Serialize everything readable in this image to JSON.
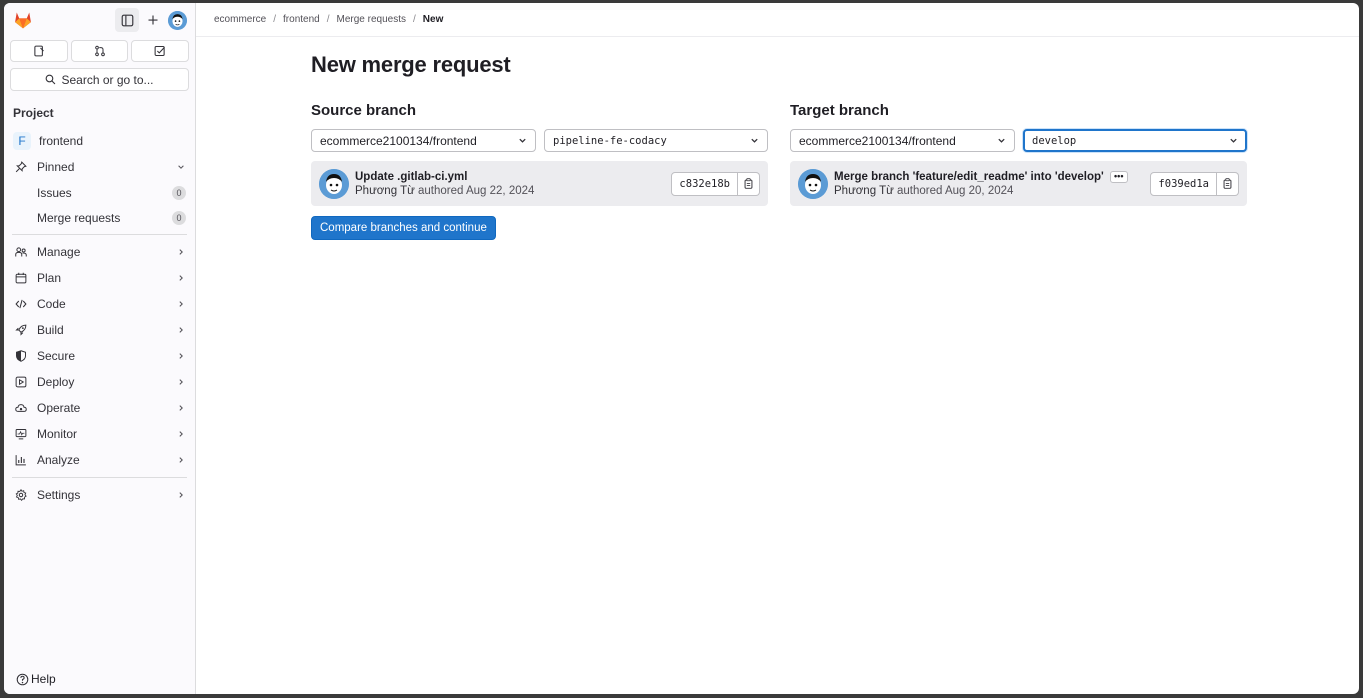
{
  "colors": {
    "primary": "#1f75cb",
    "sidebar_bg": "#fbfafd",
    "orange": "#e24329"
  },
  "sidebar": {
    "top_icons": [
      "gitlab-logo",
      "sidebar-toggle-icon",
      "plus-icon",
      "user-avatar"
    ],
    "quick_icons": [
      "issues-icon",
      "merge-request-icon",
      "todo-icon"
    ],
    "search_label": "Search or go to...",
    "section_title": "Project",
    "project": {
      "badge": "F",
      "name": "frontend"
    },
    "pinned": {
      "label": "Pinned",
      "items": [
        {
          "label": "Issues",
          "count": "0"
        },
        {
          "label": "Merge requests",
          "count": "0"
        }
      ]
    },
    "menu": [
      {
        "label": "Manage",
        "icon": "users-icon"
      },
      {
        "label": "Plan",
        "icon": "calendar-icon"
      },
      {
        "label": "Code",
        "icon": "code-icon"
      },
      {
        "label": "Build",
        "icon": "rocket-icon"
      },
      {
        "label": "Secure",
        "icon": "shield-icon"
      },
      {
        "label": "Deploy",
        "icon": "deploy-icon"
      },
      {
        "label": "Operate",
        "icon": "cloud-icon"
      },
      {
        "label": "Monitor",
        "icon": "monitor-icon"
      },
      {
        "label": "Analyze",
        "icon": "chart-icon"
      }
    ],
    "settings": "Settings",
    "help": "Help"
  },
  "breadcrumb": [
    "ecommerce",
    "frontend",
    "Merge requests",
    "New"
  ],
  "page_title": "New merge request",
  "source": {
    "heading": "Source branch",
    "project": "ecommerce2100134/frontend",
    "branch": "pipeline-fe-codacy",
    "commit": {
      "title": "Update .gitlab-ci.yml",
      "author": "Phương Từ",
      "meta": "authored Aug 22, 2024",
      "sha": "c832e18b"
    }
  },
  "target": {
    "heading": "Target branch",
    "project": "ecommerce2100134/frontend",
    "branch": "develop",
    "commit": {
      "title": "Merge branch 'feature/edit_readme' into 'develop'",
      "author": "Phương Từ",
      "meta": "authored Aug 20, 2024",
      "sha": "f039ed1a",
      "ellipsis": "•••"
    }
  },
  "compare_button": "Compare branches and continue"
}
